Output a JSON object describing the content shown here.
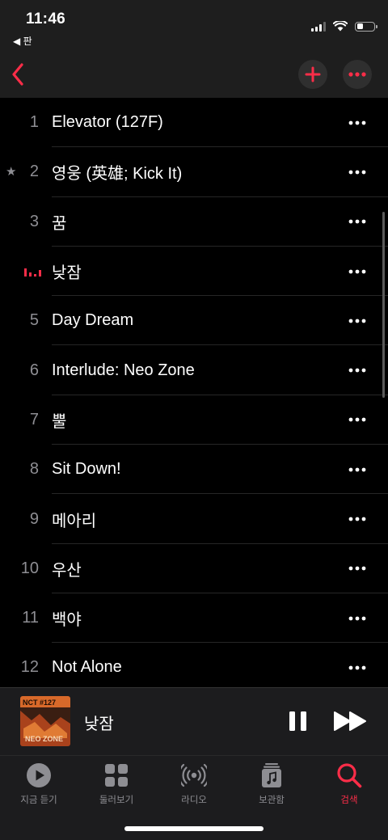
{
  "status_bar": {
    "time": "11:46",
    "back_app": "◀ 판"
  },
  "colors": {
    "accent": "#fa2d48",
    "background": "#000000",
    "secondary_text": "#8e8e93"
  },
  "tracks": [
    {
      "number": "1",
      "title": "Elevator (127F)"
    },
    {
      "number": "2",
      "title": "영웅 (英雄; Kick It)",
      "starred": true
    },
    {
      "number": "3",
      "title": "꿈"
    },
    {
      "number": "",
      "title": "낮잠",
      "now_playing": true
    },
    {
      "number": "5",
      "title": "Day Dream"
    },
    {
      "number": "6",
      "title": "Interlude: Neo Zone"
    },
    {
      "number": "7",
      "title": "뿔"
    },
    {
      "number": "8",
      "title": "Sit Down!"
    },
    {
      "number": "9",
      "title": "메아리"
    },
    {
      "number": "10",
      "title": "우산"
    },
    {
      "number": "11",
      "title": "백야"
    },
    {
      "number": "12",
      "title": "Not Alone"
    }
  ],
  "now_playing": {
    "title": "낮잠",
    "album_art_text_top": "NCT #127",
    "album_art_text_bottom": "NEO ZONE"
  },
  "tabs": [
    {
      "label": "지금 듣기",
      "icon": "play-circle-icon"
    },
    {
      "label": "둘러보기",
      "icon": "grid-icon"
    },
    {
      "label": "라디오",
      "icon": "radio-icon"
    },
    {
      "label": "보관함",
      "icon": "library-icon"
    },
    {
      "label": "검색",
      "icon": "search-icon",
      "active": true
    }
  ]
}
